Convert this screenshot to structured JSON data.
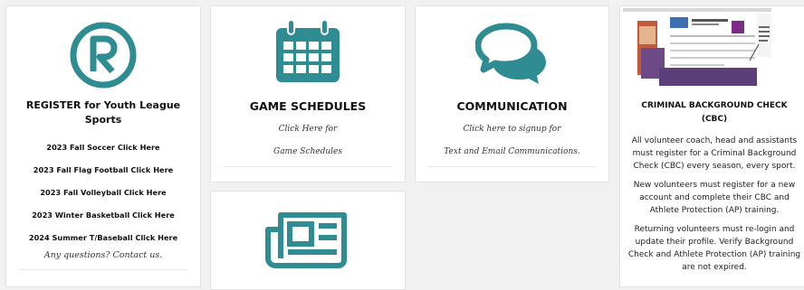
{
  "colors": {
    "accent": "#2f8c93"
  },
  "register_card": {
    "icon": "registered-trademark-icon",
    "title": "REGISTER for Youth League Sports",
    "links": [
      {
        "label": "2023 Fall Soccer Click Here"
      },
      {
        "label": "2023 Fall Flag Football Click Here"
      },
      {
        "label": "2023 Fall Volleyball Click Here"
      },
      {
        "label": "2023 Winter Basketball   Click Here"
      },
      {
        "label": "2024 Summer T/Baseball   Click Here"
      }
    ],
    "questions": "Any questions? Contact us."
  },
  "schedules_card": {
    "icon": "calendar-icon",
    "title": "GAME SCHEDULES",
    "line1": "Click Here for",
    "line2": "Game Schedules"
  },
  "communication_card": {
    "icon": "chat-bubbles-icon",
    "title": "COMMUNICATION",
    "line1": "Click here to signup for",
    "line2": "Text and Email Communications."
  },
  "cbc_card": {
    "image": "cbc-screenshot-thumbnail",
    "title": "CRIMINAL BACKGROUND CHECK (CBC)",
    "paragraphs": [
      "All volunteer coach, head and assistants must register for a Criminal Background Check (CBC) every season, every sport.",
      "New volunteers must register for a new account and complete their CBC and Athlete Protection (AP) training.",
      "Returning volunteers must re-login and update their profile.  Verify Background Check and Athlete Protection (AP) training are not expired."
    ]
  },
  "news_card": {
    "icon": "newspaper-icon"
  }
}
